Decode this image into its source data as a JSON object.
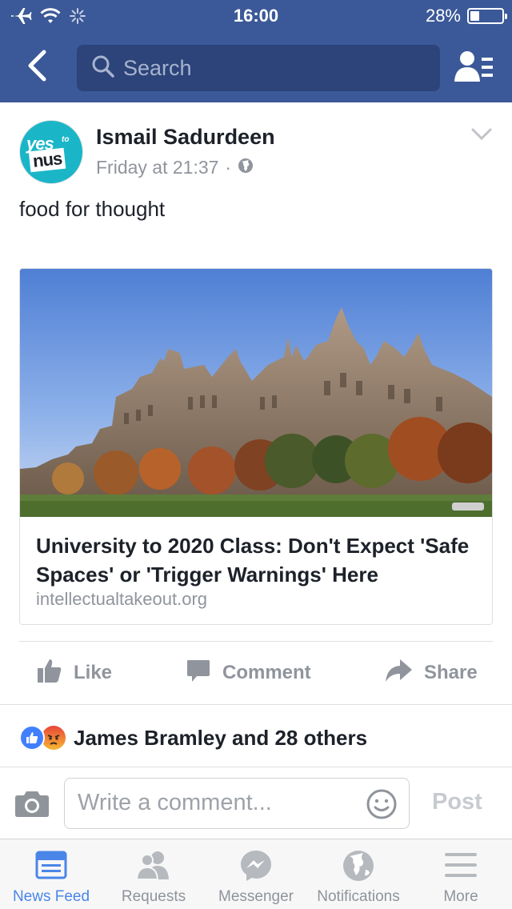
{
  "status_bar": {
    "time": "16:00",
    "battery": "28%",
    "battery_level": 0.28
  },
  "nav": {
    "search_placeholder": "Search",
    "back_icon": "chevron-left-icon",
    "friends_icon": "friend-requests-icon"
  },
  "post": {
    "author": "Ismail Sadurdeen",
    "timestamp": "Friday at 21:37",
    "privacy_icon": "globe-icon",
    "text": "food for thought",
    "avatar_logo": {
      "line1": "yes",
      "small": "to",
      "line2": "nus"
    },
    "link": {
      "title": "University to 2020 Class: Don't Expect 'Safe Spaces' or 'Trigger Warnings' Here",
      "domain": "intellectualtakeout.org"
    },
    "actions": {
      "like": "Like",
      "comment": "Comment",
      "share": "Share"
    },
    "reactions_summary": "James Bramley and 28 others"
  },
  "composer": {
    "placeholder": "Write a comment...",
    "post_label": "Post"
  },
  "tabbar": {
    "items": [
      {
        "label": "News Feed",
        "icon": "news-feed-icon",
        "active": true
      },
      {
        "label": "Requests",
        "icon": "requests-icon",
        "active": false
      },
      {
        "label": "Messenger",
        "icon": "messenger-icon",
        "active": false
      },
      {
        "label": "Notifications",
        "icon": "globe-icon",
        "active": false
      },
      {
        "label": "More",
        "icon": "menu-icon",
        "active": false
      }
    ]
  },
  "colors": {
    "brand_blue": "#3b5998",
    "active_tab": "#4a86e8",
    "muted_text": "#90949c"
  }
}
